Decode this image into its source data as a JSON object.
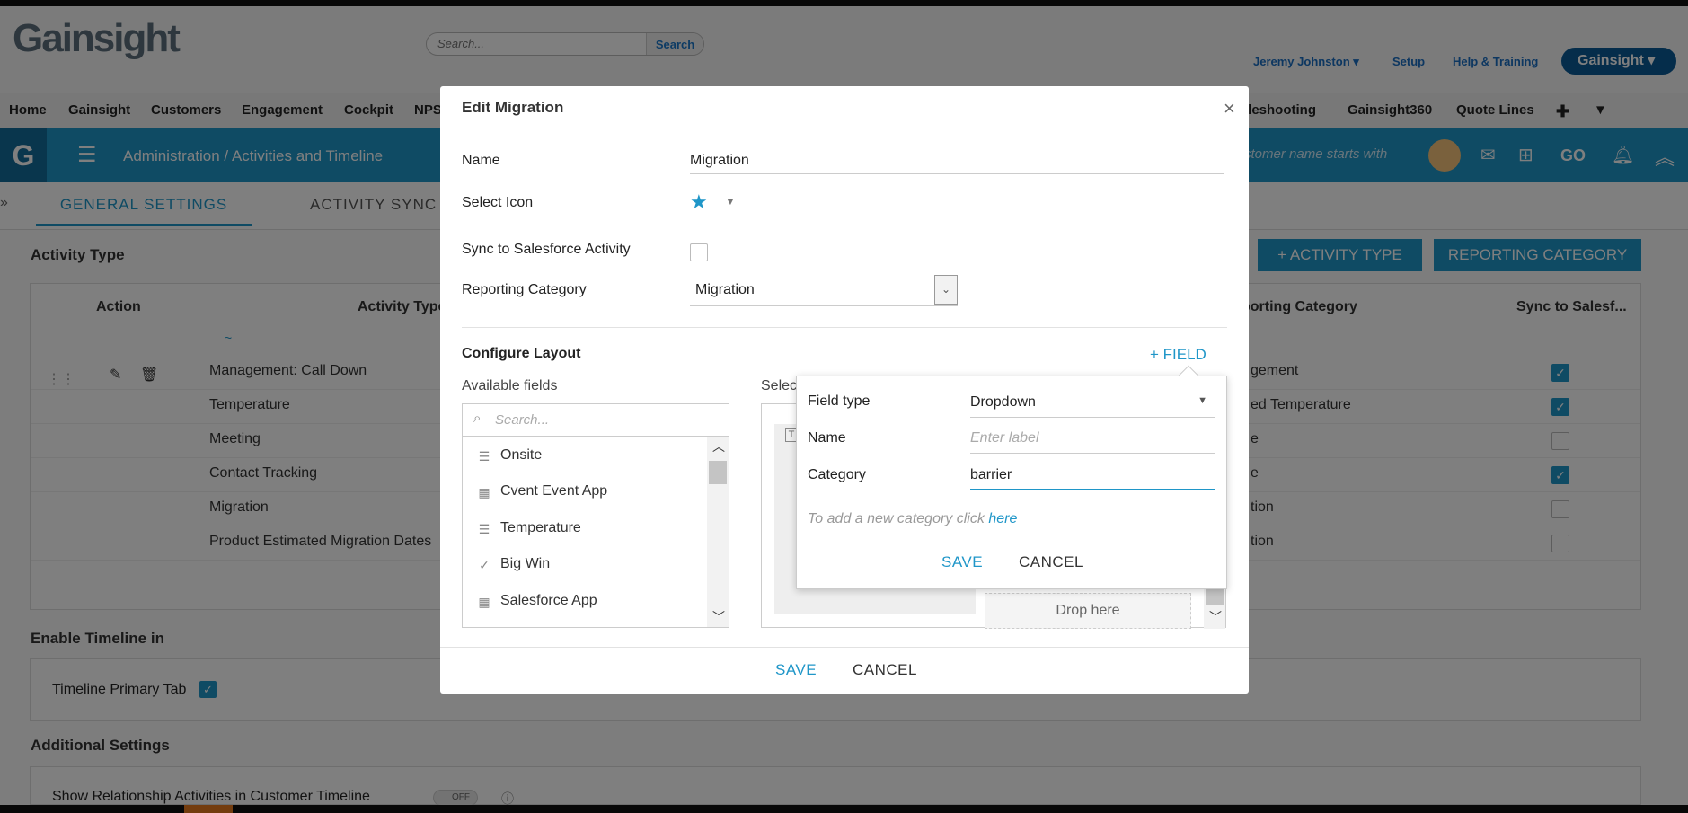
{
  "header": {
    "logo": "Gainsight",
    "search_placeholder": "Search...",
    "search_button": "Search",
    "user": "Jeremy Johnston",
    "setup": "Setup",
    "help": "Help & Training",
    "org_button": "Gainsight"
  },
  "nav": {
    "items": [
      "Home",
      "Gainsight",
      "Customers",
      "Engagement",
      "Cockpit",
      "NPS"
    ],
    "right_items": [
      "bleshooting",
      "Gainsight360",
      "Quote Lines"
    ]
  },
  "subheader": {
    "logo_letter": "G",
    "breadcrumb": "Administration / Activities and Timeline",
    "search_placeholder": "stomer name starts with",
    "go": "GO"
  },
  "tabs": {
    "general": "GENERAL SETTINGS",
    "sync": "ACTIVITY SYNC"
  },
  "page": {
    "activity_type_title": "Activity Type",
    "add_activity_type": "+ ACTIVITY TYPE",
    "reporting_category_button": "REPORTING CATEGORY",
    "col_action": "Action",
    "col_activity_type": "Activity Type",
    "col_reporting_category": "porting Category",
    "col_sync": "Sync to Salesf...",
    "filter_symbol": "~",
    "rows": [
      {
        "name": "Management: Call Down",
        "category": "gement",
        "synced": true
      },
      {
        "name": "Temperature",
        "category": "ed Temperature",
        "synced": true
      },
      {
        "name": "Meeting",
        "category": "e",
        "synced": false
      },
      {
        "name": "Contact Tracking",
        "category": "e",
        "synced": true
      },
      {
        "name": "Migration",
        "category": "tion",
        "synced": false
      },
      {
        "name": "Product Estimated Migration Dates",
        "category": "tion",
        "synced": false
      }
    ],
    "enable_timeline_title": "Enable Timeline in",
    "timeline_primary_tab": "Timeline Primary Tab",
    "additional_settings_title": "Additional Settings",
    "show_relationship": "Show Relationship Activities in Customer Timeline",
    "toggle_off": "OFF"
  },
  "modal": {
    "title": "Edit Migration",
    "name_label": "Name",
    "name_value": "Migration",
    "icon_label": "Select Icon",
    "sync_label": "Sync to Salesforce Activity",
    "reporting_label": "Reporting Category",
    "reporting_value": "Migration",
    "configure_layout": "Configure Layout",
    "add_field": "+ FIELD",
    "available_fields": "Available fields",
    "selected_fields": "Selec",
    "search_placeholder": "Search...",
    "fields": [
      {
        "label": "Onsite",
        "icon": "list-icon"
      },
      {
        "label": "Cvent Event App",
        "icon": "grid-icon"
      },
      {
        "label": "Temperature",
        "icon": "list-icon"
      },
      {
        "label": "Big Win",
        "icon": "checkbox-icon"
      },
      {
        "label": "Salesforce App",
        "icon": "grid-icon"
      }
    ],
    "drop_here": "Drop here",
    "save": "SAVE",
    "cancel": "CANCEL"
  },
  "popover": {
    "field_type_label": "Field type",
    "field_type_value": "Dropdown",
    "name_label": "Name",
    "name_placeholder": "Enter label",
    "category_label": "Category",
    "category_value": "barrier",
    "hint": "To add a new category click",
    "hint_link": "here",
    "save": "SAVE",
    "cancel": "CANCEL"
  },
  "colors": {
    "accent": "#1f96c8",
    "dark_blue": "#0a5a97"
  }
}
